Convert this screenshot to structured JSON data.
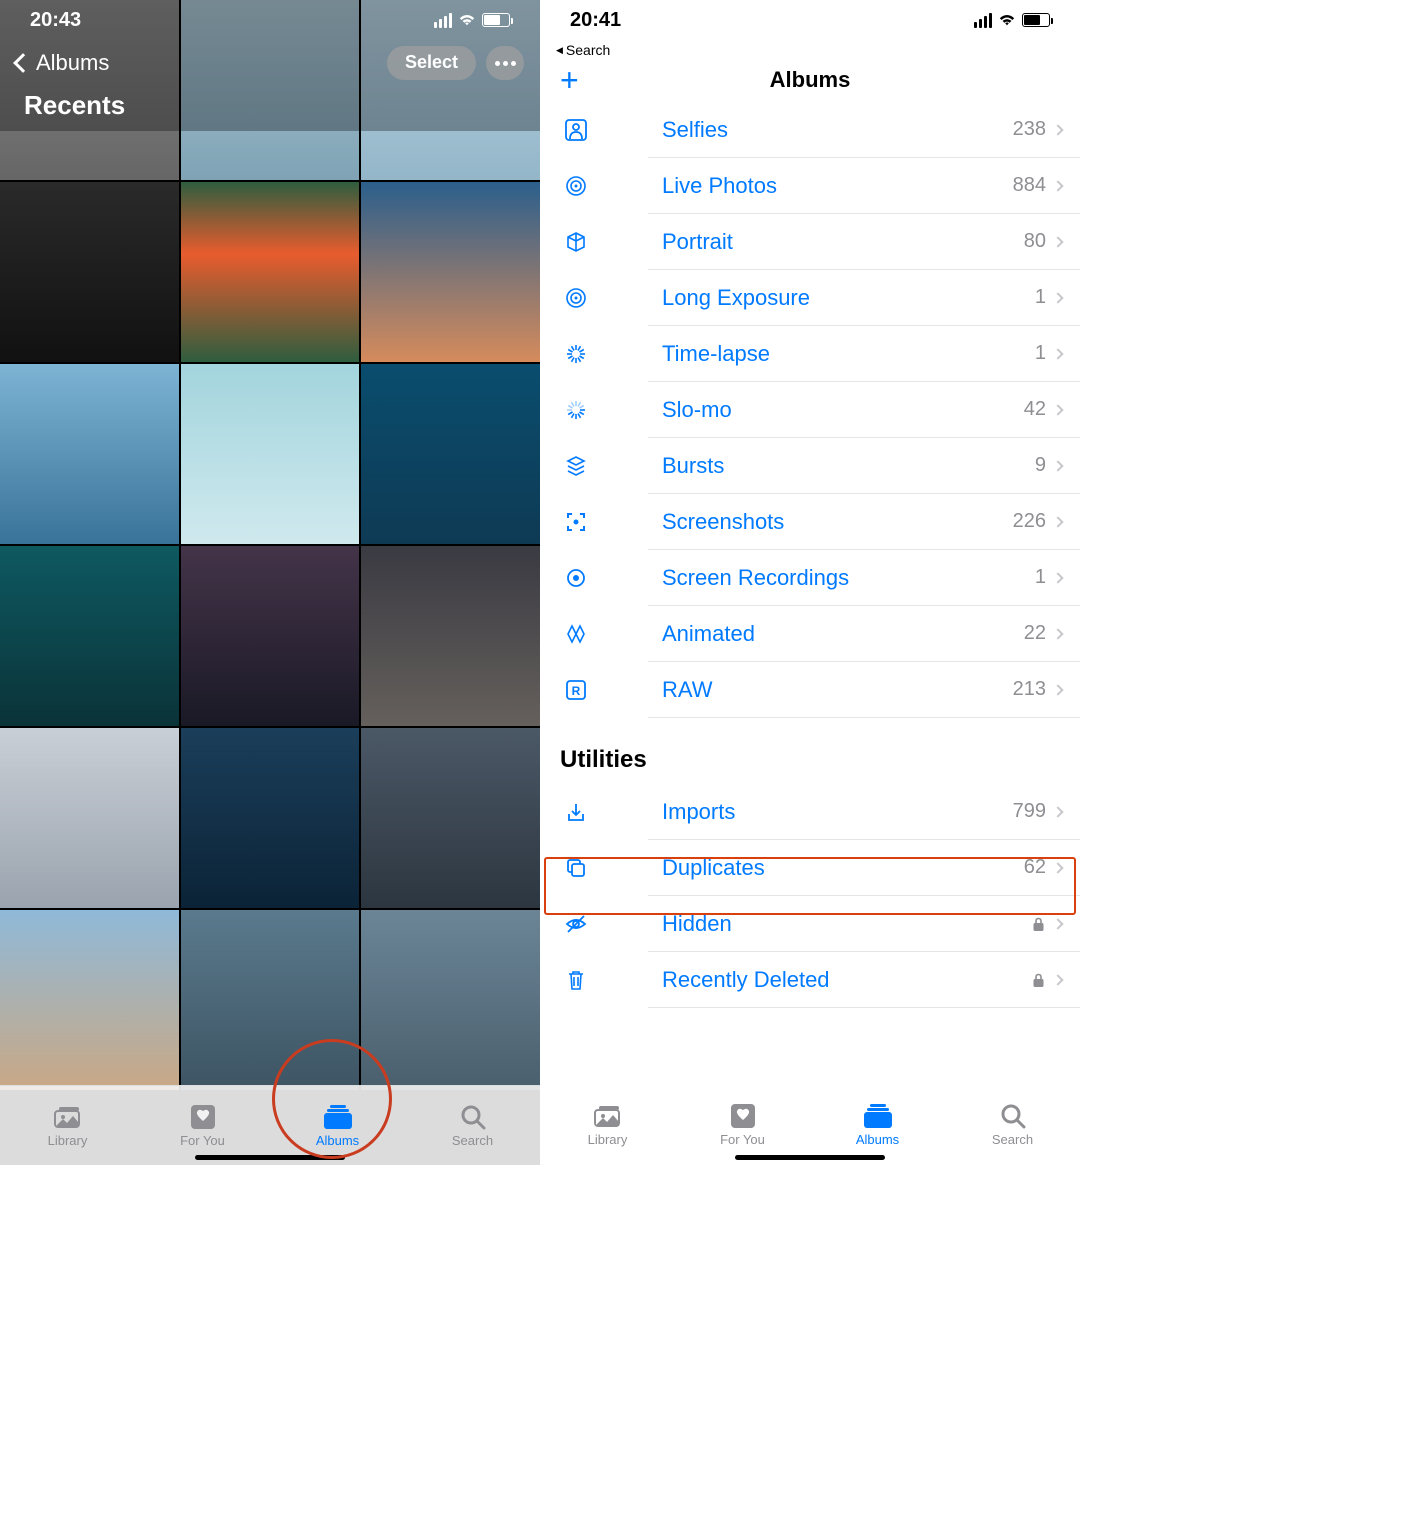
{
  "left": {
    "status_time": "20:43",
    "back_label": "Albums",
    "page_title": "Recents",
    "select_label": "Select",
    "tabs": [
      {
        "label": "Library"
      },
      {
        "label": "For You"
      },
      {
        "label": "Albums"
      },
      {
        "label": "Search"
      }
    ],
    "thumb_colors": [
      "linear-gradient(#888,#666)",
      "linear-gradient(#a9c5d3,#7fa3b5)",
      "linear-gradient(#b8d4e4,#93b6c8)",
      "linear-gradient(#2a2a2a,#111)",
      "linear-gradient(#2e5d3e,#e85c2e 40%,#2e5d3e)",
      "linear-gradient(#2b5f8c,#d68b5c)",
      "linear-gradient(#7db4d4,#3a7399)",
      "linear-gradient(#a3d4dd,#cfe9ee)",
      "linear-gradient(#0a4d6e,#0e3a54)",
      "linear-gradient(#0e5961,#0a3338)",
      "linear-gradient(#443449,#1a1926)",
      "linear-gradient(#3a3a42,#65605c)",
      "linear-gradient(#c9cfd6,#9aa3ae)",
      "linear-gradient(#1b3e5a,#0b2337)",
      "linear-gradient(#4b5866,#2c3640)",
      "linear-gradient(#8fb9d8,#c9a885)",
      "linear-gradient(#5a7a8d,#3d5463)",
      "linear-gradient(#6b8597,#4a5f6d)"
    ]
  },
  "right": {
    "status_time": "20:41",
    "back_search_label": "Search",
    "nav_title": "Albums",
    "tabs": [
      {
        "label": "Library"
      },
      {
        "label": "For You"
      },
      {
        "label": "Albums"
      },
      {
        "label": "Search"
      }
    ],
    "media_types": [
      {
        "icon": "person-square",
        "label": "Selfies",
        "count": "238"
      },
      {
        "icon": "concentric",
        "label": "Live Photos",
        "count": "884"
      },
      {
        "icon": "cube",
        "label": "Portrait",
        "count": "80"
      },
      {
        "icon": "concentric",
        "label": "Long Exposure",
        "count": "1"
      },
      {
        "icon": "burst",
        "label": "Time-lapse",
        "count": "1"
      },
      {
        "icon": "burst-partial",
        "label": "Slo-mo",
        "count": "42"
      },
      {
        "icon": "stack",
        "label": "Bursts",
        "count": "9"
      },
      {
        "icon": "corners",
        "label": "Screenshots",
        "count": "226"
      },
      {
        "icon": "dot-circle",
        "label": "Screen Recordings",
        "count": "1"
      },
      {
        "icon": "diamonds",
        "label": "Animated",
        "count": "22"
      },
      {
        "icon": "r-square",
        "label": "RAW",
        "count": "213"
      }
    ],
    "utilities_header": "Utilities",
    "utilities": [
      {
        "icon": "import",
        "label": "Imports",
        "count": "799",
        "lock": false
      },
      {
        "icon": "duplicate",
        "label": "Duplicates",
        "count": "62",
        "lock": false
      },
      {
        "icon": "eye-slash",
        "label": "Hidden",
        "count": "",
        "lock": true
      },
      {
        "icon": "trash",
        "label": "Recently Deleted",
        "count": "",
        "lock": true
      }
    ]
  }
}
